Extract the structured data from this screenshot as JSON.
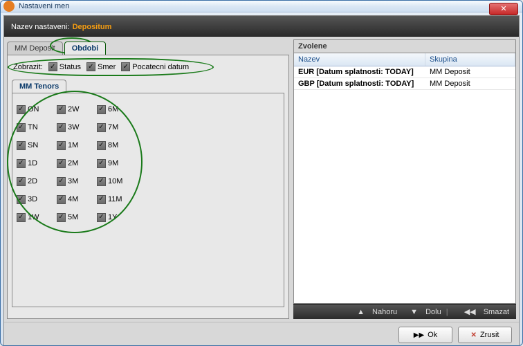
{
  "window": {
    "title": "Nastaveni men",
    "close_glyph": "✕"
  },
  "header": {
    "label": "Nazev nastaveni:",
    "value": "Depositum"
  },
  "tabs": {
    "mm_deposit": "MM Deposit",
    "obdobi": "Obdobi"
  },
  "zobrazit": {
    "label": "Zobrazit:",
    "status": "Status",
    "smer": "Smer",
    "pocatecni": "Pocatecni datum"
  },
  "tenors": {
    "title": "MM Tenors",
    "items": [
      "ON",
      "2W",
      "6M",
      "TN",
      "3W",
      "7M",
      "SN",
      "1M",
      "8M",
      "1D",
      "2M",
      "9M",
      "2D",
      "3M",
      "10M",
      "3D",
      "4M",
      "11M",
      "1W",
      "5M",
      "1Y"
    ]
  },
  "zvolene": {
    "title": "Zvolene",
    "columns": {
      "nazev": "Nazev",
      "skupina": "Skupina"
    },
    "rows": [
      {
        "nazev": "EUR [Datum splatnosti: TODAY]",
        "skupina": "MM Deposit"
      },
      {
        "nazev": "GBP [Datum splatnosti: TODAY]",
        "skupina": "MM Deposit"
      }
    ]
  },
  "list_controls": {
    "up": "Nahoru",
    "down": "Dolu",
    "delete": "Smazat",
    "up_glyph": "▲",
    "down_glyph": "▼",
    "rew_glyph": "◀◀"
  },
  "footer": {
    "ok": "Ok",
    "ok_glyph": "▶▶",
    "cancel": "Zrusit",
    "cancel_glyph": "✕"
  }
}
